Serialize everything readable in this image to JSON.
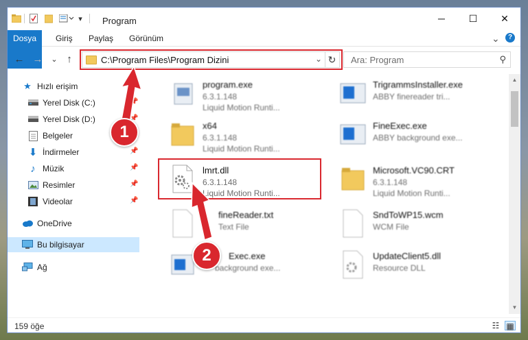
{
  "window": {
    "title": "Program"
  },
  "controls": {
    "minimize": "─",
    "maximize": "☐",
    "close": "✕"
  },
  "ribbon": {
    "tabs": [
      "Dosya",
      "Giriş",
      "Paylaş",
      "Görünüm"
    ],
    "expand": "⌄",
    "help": "?"
  },
  "nav": {
    "back": "←",
    "forward": "→",
    "recent": "⌄",
    "up": "↑",
    "address": "C:\\Program Files\\Program Dizini",
    "address_dd": "⌄",
    "refresh": "↻",
    "search_placeholder": "Ara: Program",
    "search_icon": "⚲"
  },
  "sidebar": {
    "items": [
      {
        "label": "Hızlı erişim",
        "icon": "star-icon"
      },
      {
        "label": "Yerel Disk (C:)",
        "icon": "drive-icon"
      },
      {
        "label": "Yerel Disk (D:)",
        "icon": "drive-icon"
      },
      {
        "label": "Belgeler",
        "icon": "documents-icon"
      },
      {
        "label": "İndirmeler",
        "icon": "download-icon"
      },
      {
        "label": "Müzik",
        "icon": "music-icon"
      },
      {
        "label": "Resimler",
        "icon": "pictures-icon"
      },
      {
        "label": "Videolar",
        "icon": "video-icon"
      },
      {
        "label": "OneDrive",
        "icon": "cloud-icon"
      },
      {
        "label": "Bu bilgisayar",
        "icon": "computer-icon"
      },
      {
        "label": "Ağ",
        "icon": "network-icon"
      }
    ]
  },
  "files": [
    {
      "name": "program.exe",
      "line1": "6.3.1.148",
      "line2": "Liquid Motion Runti..."
    },
    {
      "name": "x64",
      "line1": "6.3.1.148",
      "line2": "Liquid Motion Runti..."
    },
    {
      "name": "lmrt.dll",
      "line1": "6.3.1.148",
      "line2": "Liquid Motion Runti..."
    },
    {
      "name": "fineReader.txt",
      "line1": "Text File",
      "line2": ""
    },
    {
      "name": "Exec.exe",
      "line1": "background exe...",
      "line2": ""
    },
    {
      "name": "TrigrammsInstaller.exe",
      "line1": "ABBY finereader tri...",
      "line2": ""
    },
    {
      "name": "FineExec.exe",
      "line1": "ABBY background exe...",
      "line2": ""
    },
    {
      "name": "Microsoft.VC90.CRT",
      "line1": "6.3.1.148",
      "line2": "Liquid Motion Runti..."
    },
    {
      "name": "SndToWP15.wcm",
      "line1": "WCM File",
      "line2": ""
    },
    {
      "name": "UpdateClient5.dll",
      "line1": "Resource DLL",
      "line2": ""
    }
  ],
  "status": {
    "count": "159 öğe",
    "details_view": "☷",
    "icons_view": "▦"
  },
  "annotations": {
    "step1": "1",
    "step2": "2",
    "color": "#d9272e"
  },
  "colors": {
    "accent": "#1979ca",
    "selection": "#cce8ff",
    "highlight": "#d9272e"
  }
}
